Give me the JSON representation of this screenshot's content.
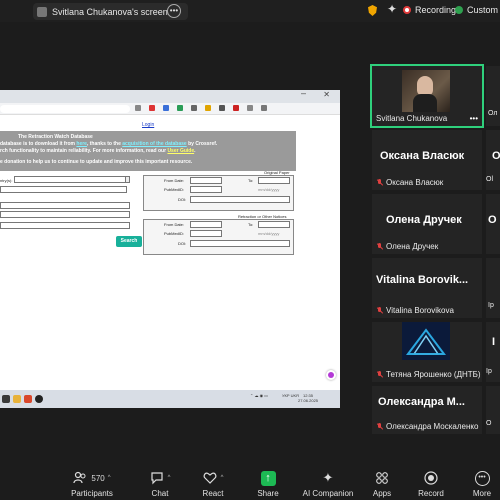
{
  "topbar": {
    "share_title": "Svitlana Chukanova's screen",
    "recording_label": "Recording",
    "custom_label": "Custom Li"
  },
  "shared_screen": {
    "login_link": "Login",
    "banner_title": "The Retraction Watch Database",
    "banner_line1_a": "database is to download it from ",
    "banner_line1_link1": "here",
    "banner_line1_b": ", thanks to the ",
    "banner_line1_link2": "acquisition of the database",
    "banner_line1_c": " by Crossref.",
    "banner_line2_a": "rch functionality to maintain reliability. For more information, read our ",
    "banner_line2_link": "User Guide",
    "banner_line2_b": ".",
    "donate_text": "e donation to help us to continue to update and improve this important resource.",
    "field_country": "ntry(s):",
    "original_paper_title": "Original Paper",
    "from_date_label": "From Date:",
    "to_label": "To:",
    "pubmed_label": "PubMedID:",
    "doi_label": "DOI:",
    "date_format": "mm/dd/yyyy",
    "retraction_title": "Retraction or Other Notices",
    "search_button": "Search",
    "tray_lang": "УКР\nUKR",
    "tray_time": "12:35",
    "tray_date": "27.06.2025"
  },
  "participants": [
    {
      "display": "",
      "name": "Svitlana Chukanova",
      "type": "video"
    },
    {
      "display": "Оксана Власюк",
      "name": "Оксана Власюк",
      "type": "name"
    },
    {
      "display": "Олена Дручек",
      "name": "Олена Дручек",
      "type": "name"
    },
    {
      "display": "Vitalina  Borovik...",
      "name": "Vitalina Borovikova",
      "type": "name"
    },
    {
      "display": "",
      "name": "Тетяна Ярошенко (ДНТБ)",
      "type": "logo"
    },
    {
      "display": "Олександра  М...",
      "name": "Олександра Москаленко",
      "type": "name"
    }
  ],
  "participants_partial": [
    {
      "display": "О",
      "name": "Ол"
    },
    {
      "display": "О",
      "name": "Ol"
    },
    {
      "display": "О",
      "name": "О"
    },
    {
      "display": "",
      "name": "Ір"
    },
    {
      "display": "І",
      "name": "Ір"
    },
    {
      "display": "",
      "name": "О"
    }
  ],
  "toolbar": {
    "participants_label": "Participants",
    "participants_count": "570",
    "chat_label": "Chat",
    "react_label": "React",
    "share_label": "Share",
    "ai_label": "AI Companion",
    "apps_label": "Apps",
    "record_label": "Record",
    "more_label": "More"
  },
  "colors": {
    "active_speaker": "#2fd07c",
    "share_green": "#1db954",
    "muted_red": "#e04040",
    "search_button": "#18b09a"
  }
}
